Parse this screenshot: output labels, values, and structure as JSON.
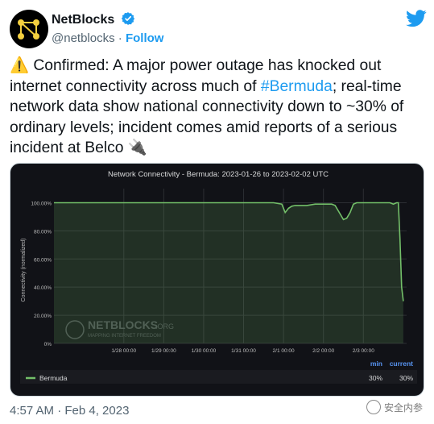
{
  "account": {
    "display_name": "NetBlocks",
    "handle": "@netblocks",
    "separator": "·",
    "follow_label": "Follow"
  },
  "tweet": {
    "text_before": "⚠️ Confirmed: A major power outage has knocked out internet connectivity across much of ",
    "hashtag": "#Bermuda",
    "text_after": "; real-time network data show national connectivity down to ~30% of ordinary levels; incident comes amid reports of a serious incident at Belco 🔌"
  },
  "timestamp": "4:57 AM · Feb 4, 2023",
  "watermark_text": "安全内参",
  "colors": {
    "link": "#1d9bf0",
    "panel_bg": "#111217",
    "series": "#73bf69"
  },
  "chart_data": {
    "type": "area",
    "title": "Network Connectivity - Bermuda: 2023-01-26 to 2023-02-02 UTC",
    "ylabel": "Connectivity (normalized)",
    "xlabel": "",
    "y_ticks": [
      "0%",
      "20.00%",
      "40.00%",
      "60.00%",
      "80.00%",
      "100.00%"
    ],
    "ylim": [
      0,
      110
    ],
    "x_ticks": [
      "1/28 00:00",
      "1/29 00:00",
      "1/30 00:00",
      "1/31 00:00",
      "2/1 00:00",
      "2/2 00:00",
      "2/3 00:00"
    ],
    "xlim": [
      -42,
      170
    ],
    "series": [
      {
        "name": "Bermuda",
        "points": [
          [
            -42,
            100
          ],
          [
            0,
            100
          ],
          [
            24,
            100
          ],
          [
            48,
            100
          ],
          [
            72,
            100
          ],
          [
            90,
            100
          ],
          [
            95,
            99
          ],
          [
            97,
            93
          ],
          [
            99,
            96
          ],
          [
            101,
            97.5
          ],
          [
            103,
            98
          ],
          [
            110,
            98
          ],
          [
            115,
            99
          ],
          [
            125,
            99
          ],
          [
            127,
            98
          ],
          [
            130,
            92
          ],
          [
            132,
            88
          ],
          [
            134,
            89
          ],
          [
            136,
            93
          ],
          [
            138,
            99
          ],
          [
            140,
            100
          ],
          [
            150,
            100
          ],
          [
            160,
            100
          ],
          [
            162,
            99
          ],
          [
            164,
            100
          ],
          [
            165,
            100
          ],
          [
            166,
            75
          ],
          [
            167,
            40
          ],
          [
            168,
            30
          ]
        ],
        "min": "30%",
        "current": "30%"
      }
    ],
    "legend_headers": {
      "min": "min",
      "current": "current"
    },
    "logo_main": "NETBLOCKS",
    "logo_suffix": ".ORG",
    "logo_tagline": "MAPPING INTERNET FREEDOM",
    "grid": true,
    "legend_position": "bottom"
  }
}
